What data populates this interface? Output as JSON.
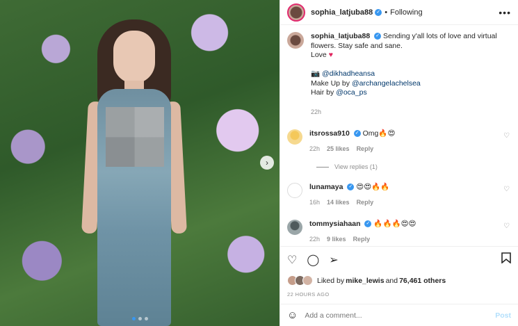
{
  "header": {
    "username": "sophia_latjuba88",
    "separator": "•",
    "following": "Following",
    "more": "•••"
  },
  "caption": {
    "username": "sophia_latjuba88",
    "text1": "Sending y'all lots of love and virtual flowers. Stay safe and sane.",
    "text2": "Love",
    "camera": "📷",
    "mention1": "@dikhadheansa",
    "makeup_prefix": "Make Up by ",
    "mention2": "@archangelachelsea",
    "hair_prefix": "Hair by ",
    "mention3": "@oca_ps",
    "time": "22h"
  },
  "comments": [
    {
      "username": "itsrossa910",
      "text": "Omg🔥😍",
      "time": "22h",
      "likes": "25 likes",
      "reply": "Reply",
      "avatar_color": "#f4c85a"
    },
    {
      "username": "lunamaya",
      "text": "😍😍🔥🔥",
      "time": "16h",
      "likes": "14 likes",
      "reply": "Reply",
      "avatar_color": "#ffffff"
    },
    {
      "username": "tommysiahaan",
      "text": "🔥🔥🔥😍😍",
      "time": "22h",
      "likes": "9 likes",
      "reply": "Reply",
      "avatar_color": "#7a8a8c"
    }
  ],
  "view_replies": "View replies (1)",
  "likes": {
    "prefix": "Liked by ",
    "user": "mike_lewis",
    "middle": " and ",
    "others": "76,461 others"
  },
  "ago": "22 HOURS AGO",
  "add_comment": {
    "placeholder": "Add a comment...",
    "post": "Post"
  },
  "icons": {
    "heart": "♡",
    "comment": "◯",
    "share": "➢",
    "save": "🔖",
    "emoji": "☺",
    "next": "›"
  },
  "colors": {
    "accent": "#3897f0",
    "story_ring": "#e12a6e",
    "post_disabled": "#b2dffc"
  }
}
